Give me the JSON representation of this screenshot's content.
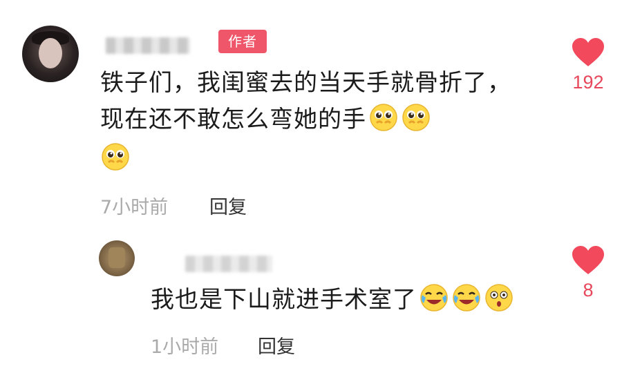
{
  "main_comment": {
    "badge": "作者",
    "text": "铁子们，我闺蜜去的当天手就骨折了，现在还不敢怎么弯她的手",
    "emojis": [
      "pleading-face-emoji",
      "pleading-face-emoji",
      "pleading-face-emoji"
    ],
    "time": "7小时前",
    "reply_label": "回复",
    "like_count": "192"
  },
  "reply_comment": {
    "text": "我也是下山就进手术室了",
    "emojis": [
      "laughing-crying-face-emoji",
      "laughing-crying-face-emoji",
      "astonished-face-emoji"
    ],
    "time": "1小时前",
    "reply_label": "回复",
    "like_count": "8"
  },
  "colors": {
    "accent": "#f0566a",
    "like": "#e8465a",
    "meta": "#aaaaaa"
  }
}
